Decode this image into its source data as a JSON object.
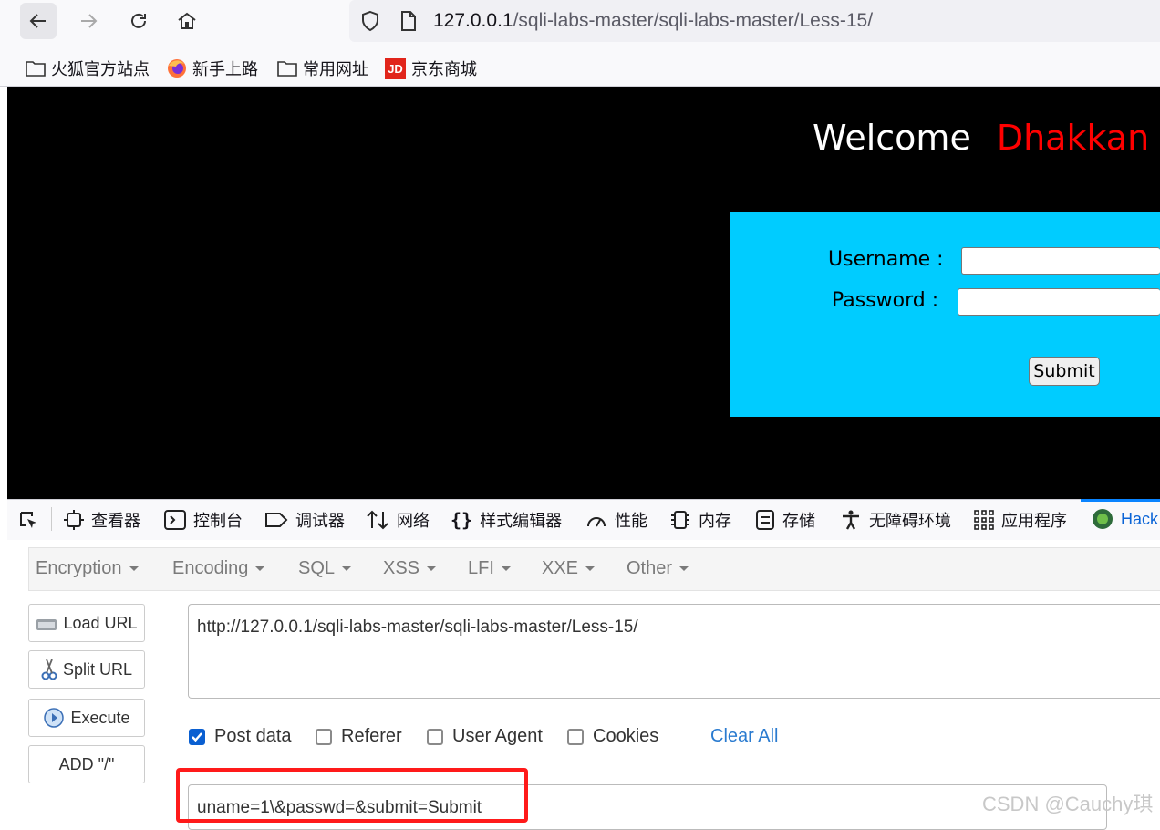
{
  "browser": {
    "url_host": "127.0.0.1",
    "url_path": "/sqli-labs-master/sqli-labs-master/Less-15/"
  },
  "bookmarks": [
    {
      "label": "火狐官方站点",
      "icon": "folder-icon"
    },
    {
      "label": "新手上路",
      "icon": "firefox-icon"
    },
    {
      "label": "常用网址",
      "icon": "folder-icon"
    },
    {
      "label": "京东商城",
      "icon": "jd-icon"
    }
  ],
  "page": {
    "welcome": "Welcome",
    "name": "Dhakkan",
    "username_label": "Username :",
    "password_label": "Password :",
    "submit_label": "Submit",
    "colors": {
      "background": "#000000",
      "login_box": "#00ccff",
      "name": "#ff0000"
    }
  },
  "devtools": {
    "tabs": [
      "查看器",
      "控制台",
      "调试器",
      "网络",
      "样式编辑器",
      "性能",
      "内存",
      "存储",
      "无障碍环境",
      "应用程序",
      "Hack"
    ]
  },
  "hackbar": {
    "menu": [
      "Encryption",
      "Encoding",
      "SQL",
      "XSS",
      "LFI",
      "XXE",
      "Other"
    ],
    "buttons": [
      "Load URL",
      "Split URL",
      "Execute",
      "ADD \"/\""
    ],
    "url_value": "http://127.0.0.1/sqli-labs-master/sqli-labs-master/Less-15/",
    "options": [
      {
        "label": "Post data",
        "checked": true
      },
      {
        "label": "Referer",
        "checked": false
      },
      {
        "label": "User Agent",
        "checked": false
      },
      {
        "label": "Cookies",
        "checked": false
      }
    ],
    "clear_all": "Clear All",
    "post_value": "uname=1\\&passwd=&submit=Submit"
  },
  "watermark": "CSDN @Cauchy琪"
}
